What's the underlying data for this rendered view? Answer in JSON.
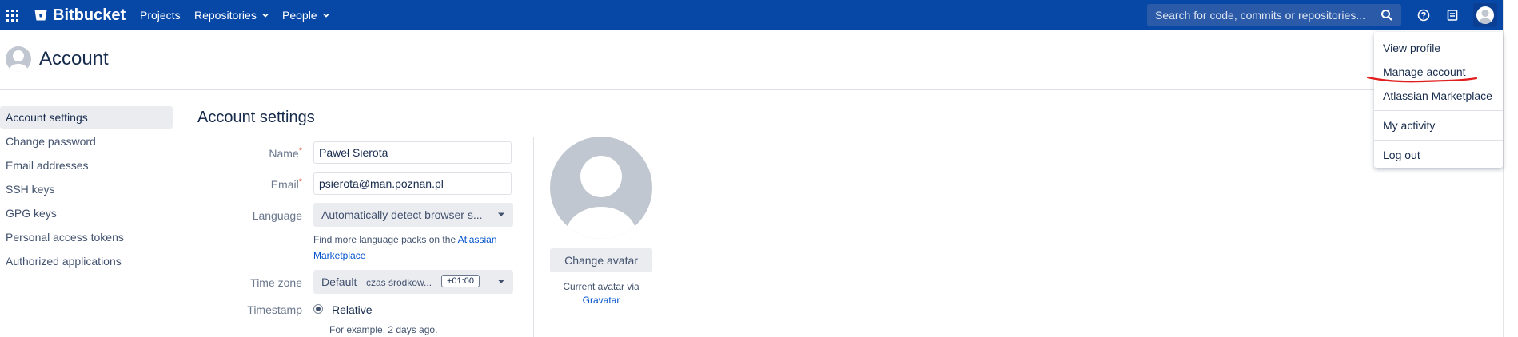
{
  "topnav": {
    "brand": "Bitbucket",
    "links": [
      "Projects",
      "Repositories",
      "People"
    ],
    "search_placeholder": "Search for code, commits or repositories...",
    "colors": {
      "bar": "#0747a6",
      "search": "#2a5aa8"
    }
  },
  "page": {
    "title": "Account"
  },
  "sidebar": {
    "items": [
      {
        "label": "Account settings",
        "active": true
      },
      {
        "label": "Change password"
      },
      {
        "label": "Email addresses"
      },
      {
        "label": "SSH keys"
      },
      {
        "label": "GPG keys"
      },
      {
        "label": "Personal access tokens"
      },
      {
        "label": "Authorized applications"
      }
    ]
  },
  "main": {
    "heading": "Account settings",
    "fields": {
      "name_label": "Name",
      "name_value": "Paweł Sierota",
      "email_label": "Email",
      "email_value": "psierota@man.poznan.pl",
      "required_mark": "*",
      "language_label": "Language",
      "language_value": "Automatically detect browser s...",
      "language_help_prefix": "Find more language packs on the ",
      "language_help_link": "Atlassian Marketplace",
      "timezone_label": "Time zone",
      "timezone_value": "Default",
      "timezone_name": "czas środkow...",
      "timezone_offset": "+01:00",
      "timestamp_label": "Timestamp",
      "timestamp_value": "Relative",
      "timestamp_example": "For example, 2 days ago."
    },
    "avatar": {
      "button": "Change avatar",
      "note_prefix": "Current avatar via",
      "note_link": "Gravatar"
    }
  },
  "dropdown": {
    "items": [
      "View profile",
      "Manage account",
      "Atlassian Marketplace",
      "My activity",
      "Log out"
    ],
    "annotation_color": "#e01e1e"
  }
}
